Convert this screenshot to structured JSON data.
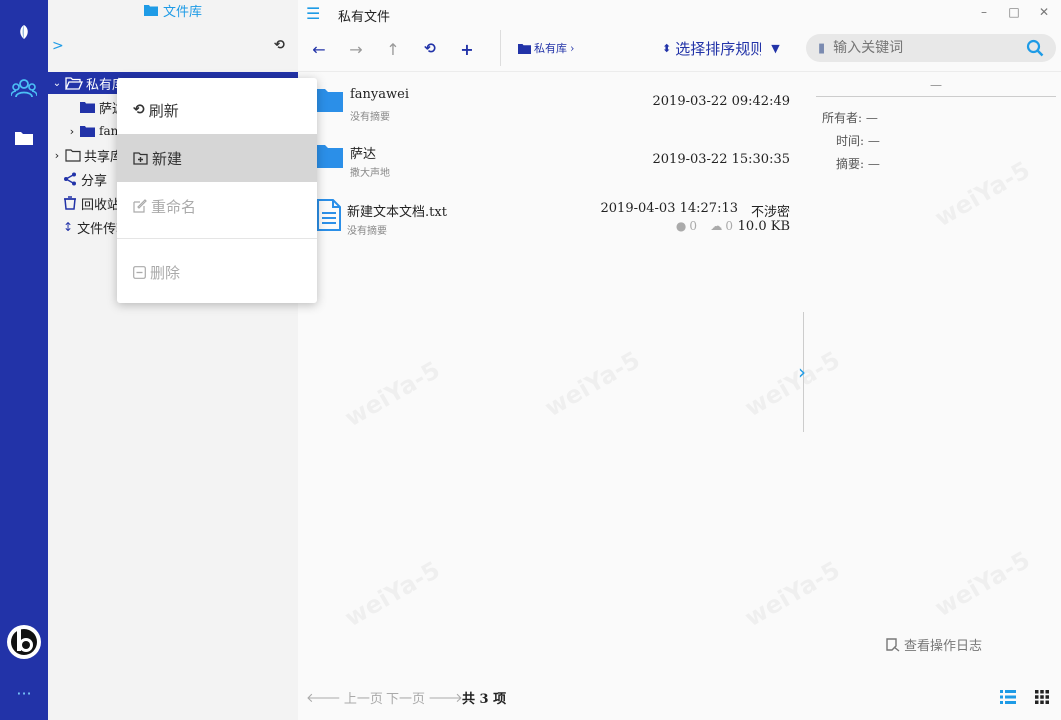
{
  "window": {
    "title": "私有文件",
    "minimize": "–",
    "maximize": "□",
    "close": "✕"
  },
  "rail": {
    "icons": [
      "leaf-icon",
      "users-icon",
      "folder-icon",
      "brand-logo",
      "more-icon"
    ],
    "more": "···"
  },
  "tree": {
    "title": "文件库",
    "items": [
      {
        "label": "私有库",
        "level": 0,
        "expanded": true,
        "selected": true
      },
      {
        "label": "萨达",
        "level": 1
      },
      {
        "label": "fanyawei",
        "level": 1
      },
      {
        "label": "共享库",
        "level": 0
      },
      {
        "label": "分享",
        "level": 0
      },
      {
        "label": "回收站",
        "level": 0
      },
      {
        "label": "文件传输",
        "level": 0
      }
    ]
  },
  "toolbar": {
    "breadcrumb": "私有库",
    "sort_label": "选择排序规则",
    "search_placeholder": "输入关键词"
  },
  "files": [
    {
      "name": "fanyawei",
      "desc": "没有摘要",
      "date": "2019-03-22 09:42:49",
      "type": "folder"
    },
    {
      "name": "萨达",
      "desc": "撒大声地",
      "date": "2019-03-22 15:30:35",
      "type": "folder"
    },
    {
      "name": "新建文本文档.txt",
      "desc": "没有摘要",
      "date": "2019-04-03 14:27:13",
      "secrecy": "不涉密",
      "views": "0",
      "downloads": "0",
      "size": "10.0 KB",
      "type": "text"
    }
  ],
  "detail": {
    "title": "—",
    "owner_label": "所有者:",
    "owner_value": "—",
    "time_label": "时间:",
    "time_value": "—",
    "summary_label": "摘要:",
    "summary_value": "—"
  },
  "log_button": "查看操作日志",
  "footer": {
    "prev": "上一页",
    "next": "下一页",
    "count": "共 3 项"
  },
  "context_menu": {
    "refresh": "刷新",
    "new": "新建",
    "rename": "重命名",
    "delete": "删除"
  },
  "watermark": "weiYa-5",
  "colors": {
    "primary": "#2233a8",
    "accent": "#1e9be6",
    "folder": "#2b8fe8"
  }
}
